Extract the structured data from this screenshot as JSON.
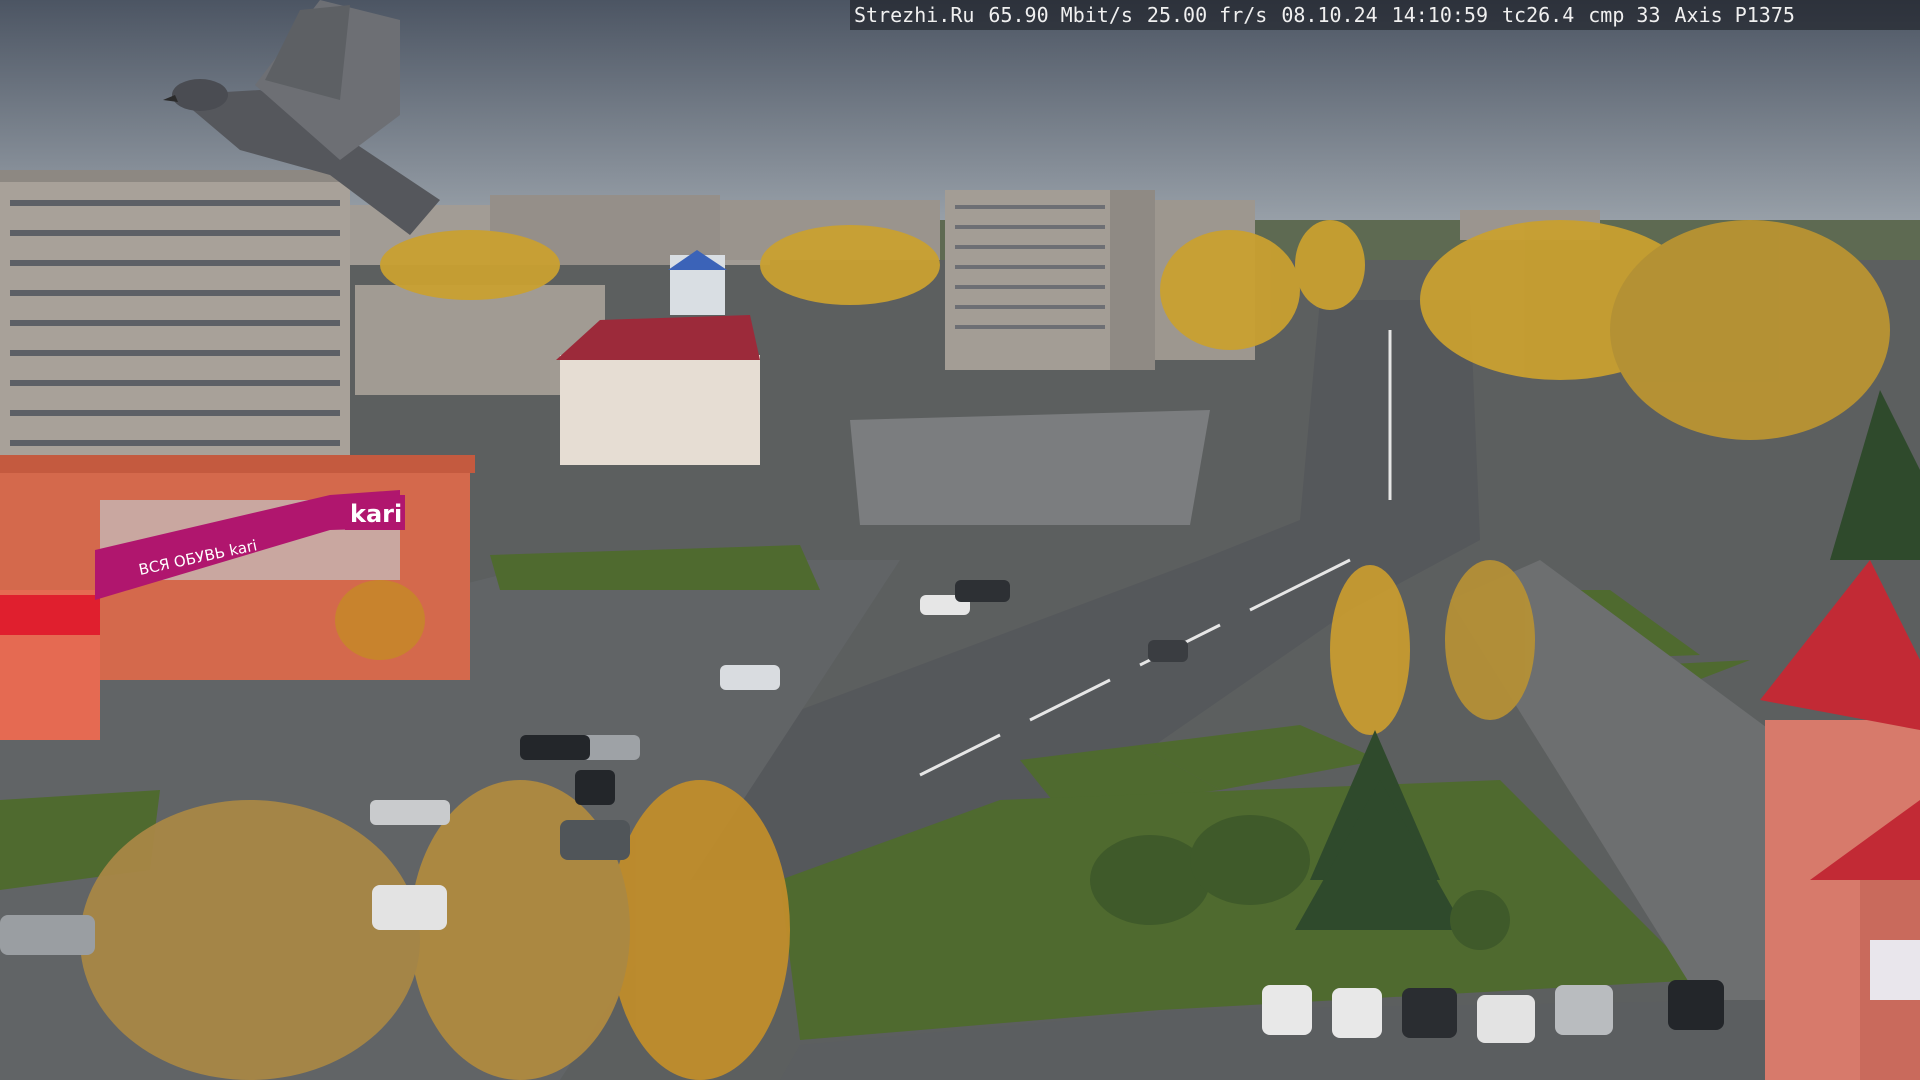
{
  "overlay": {
    "site": "Strezhi.Ru",
    "bitrate": "65.90 Mbit/s",
    "framerate": "25.00 fr/s",
    "date": "08.10.24",
    "time": "14:10:59",
    "tc": "tc26.4",
    "cmp": "cmp 33",
    "camera": "Axis P1375"
  },
  "signs": {
    "store_logo": "kari",
    "store_banner": "ВСЯ ОБУВЬ kari"
  },
  "palette": {
    "sky_top": "#4c5563",
    "sky_bottom": "#9aa3ac",
    "asphalt": "#5a5d60",
    "grass": "#4e6a2e",
    "foliage_gold": "#c9a030",
    "brick": "#d2654a",
    "magenta": "#b0166e"
  }
}
